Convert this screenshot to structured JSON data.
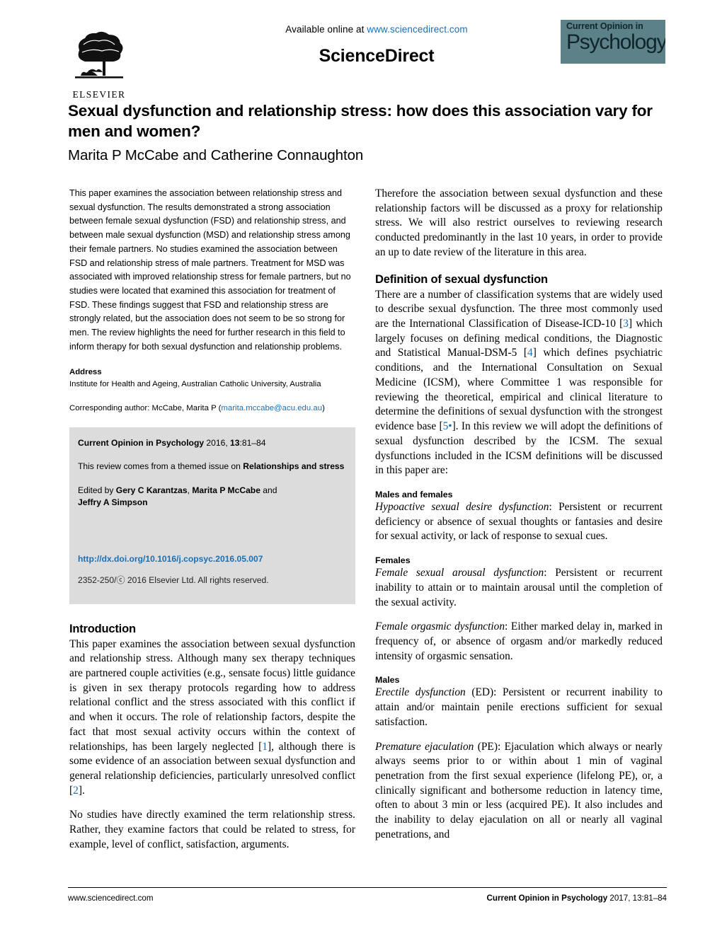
{
  "masthead": {
    "available_prefix": "Available online at ",
    "available_url": "www.sciencedirect.com",
    "sciencedirect": "ScienceDirect",
    "publisher_name": "ELSEVIER",
    "journal_badge_top": "Current Opinion in",
    "journal_badge_main": "Psychology"
  },
  "article": {
    "title": "Sexual dysfunction and relationship stress: how does this association vary for men and women?",
    "authors": "Marita P McCabe and Catherine Connaughton"
  },
  "abstract": {
    "text": "This paper examines the association between relationship stress and sexual dysfunction. The results demonstrated a strong association between female sexual dysfunction (FSD) and relationship stress, and between male sexual dysfunction (MSD) and relationship stress among their female partners. No studies examined the association between FSD and relationship stress of male partners. Treatment for MSD was associated with improved relationship stress for female partners, but no studies were located that examined this association for treatment of FSD. These findings suggest that FSD and relationship stress are strongly related, but the association does not seem to be so strong for men. The review highlights the need for further research in this field to inform therapy for both sexual dysfunction and relationship problems."
  },
  "address": {
    "heading": "Address",
    "affiliation": "Institute for Health and Ageing, Australian Catholic University, Australia",
    "corresponding_prefix": "Corresponding author: McCabe, Marita P (",
    "corresponding_email": "marita.mccabe@acu.edu.au",
    "corresponding_suffix": ")"
  },
  "citation_box": {
    "journal_bold": "Current Opinion in Psychology",
    "year_vol": " 2016, ",
    "volume_bold": "13",
    "pages": ":81–84",
    "themed_prefix": "This review comes from a themed issue on ",
    "themed_bold": "Relationships and stress",
    "edited_prefix": "Edited by ",
    "editor1": "Gery C Karantzas",
    "editor_sep1": ", ",
    "editor2": "Marita P McCabe",
    "editor_and": " and",
    "editor3": "Jeffry A Simpson",
    "doi": "http://dx.doi.org/10.1016/j.copsyc.2016.05.007",
    "copyright": "2352-250/ⓒ 2016 Elsevier Ltd. All rights reserved."
  },
  "introduction": {
    "heading": "Introduction",
    "para1_a": "This paper examines the association between sexual dysfunction and relationship stress. Although many sex therapy techniques are partnered couple activities (e.g., sensate focus) little guidance is given in sex therapy protocols regarding how to address relational conflict and the stress associated with this conflict if and when it occurs. The role of relationship factors, despite the fact that most sexual activity occurs within the context of relationships, has been largely neglected [",
    "ref1": "1",
    "para1_b": "], although there is some evidence of an association between sexual dysfunction and general relationship deficiencies, particularly unresolved conflict [",
    "ref2": "2",
    "para1_c": "].",
    "para2": "No studies have directly examined the term relationship stress. Rather, they examine factors that could be related to stress, for example, level of conflict, satisfaction, arguments."
  },
  "right_column": {
    "para_therefore": "Therefore the association between sexual dysfunction and these relationship factors will be discussed as a proxy for relationship stress. We will also restrict ourselves to reviewing research conducted predominantly in the last 10 years, in order to provide an up to date review of the literature in this area.",
    "definition_heading": "Definition of sexual dysfunction",
    "def_a": "There are a number of classification systems that are widely used to describe sexual dysfunction. The three most commonly used are the International Classification of Disease-ICD-10 [",
    "ref3": "3",
    "def_b": "] which largely focuses on defining medical conditions, the Diagnostic and Statistical Manual-DSM-5 [",
    "ref4": "4",
    "def_c": "] which defines psychiatric conditions, and the International Consultation on Sexual Medicine (ICSM), where Committee 1 was responsible for reviewing the theoretical, empirical and clinical literature to determine the definitions of sexual dysfunction with the strongest evidence base [",
    "ref5": "5•",
    "def_d": "]. In this review we will adopt the definitions of sexual dysfunction described by the ICSM. The sexual dysfunctions included in the ICSM definitions will be discussed in this paper are:",
    "males_females_heading": "Males and females",
    "hsdd_term": "Hypoactive sexual desire dysfunction",
    "hsdd_text": ": Persistent or recurrent deficiency or absence of sexual thoughts or fantasies and desire for sexual activity, or lack of response to sexual cues.",
    "females_heading": "Females",
    "fsad_term": "Female sexual arousal dysfunction",
    "fsad_text": ": Persistent or recurrent inability to attain or to maintain arousal until the completion of the sexual activity.",
    "fod_term": "Female orgasmic dysfunction",
    "fod_text": ": Either marked delay in, marked in frequency of, or absence of orgasm and/or markedly reduced intensity of orgasmic sensation.",
    "males_heading": "Males",
    "ed_term": "Erectile dysfunction",
    "ed_abbrev": " (ED)",
    "ed_text": ": Persistent or recurrent inability to attain and/or maintain penile erections sufficient for sexual satisfaction.",
    "pe_term": "Premature ejaculation",
    "pe_abbrev": " (PE)",
    "pe_text": ": Ejaculation which always or nearly always seems prior to or within about 1 min of vaginal penetration from the first sexual experience (lifelong PE), or, a clinically significant and bothersome reduction in latency time, often to about 3 min or less (acquired PE). It also includes and the inability to delay ejaculation on all or nearly all vaginal penetrations, and"
  },
  "footer": {
    "left": "www.sciencedirect.com",
    "right_bold": "Current Opinion in Psychology",
    "right_light": " 2017, 13:81–84"
  },
  "colors": {
    "link_blue": "#1a6fb5",
    "journal_teal": "#5d8189",
    "cite_box_gray": "#dcdcdc"
  }
}
